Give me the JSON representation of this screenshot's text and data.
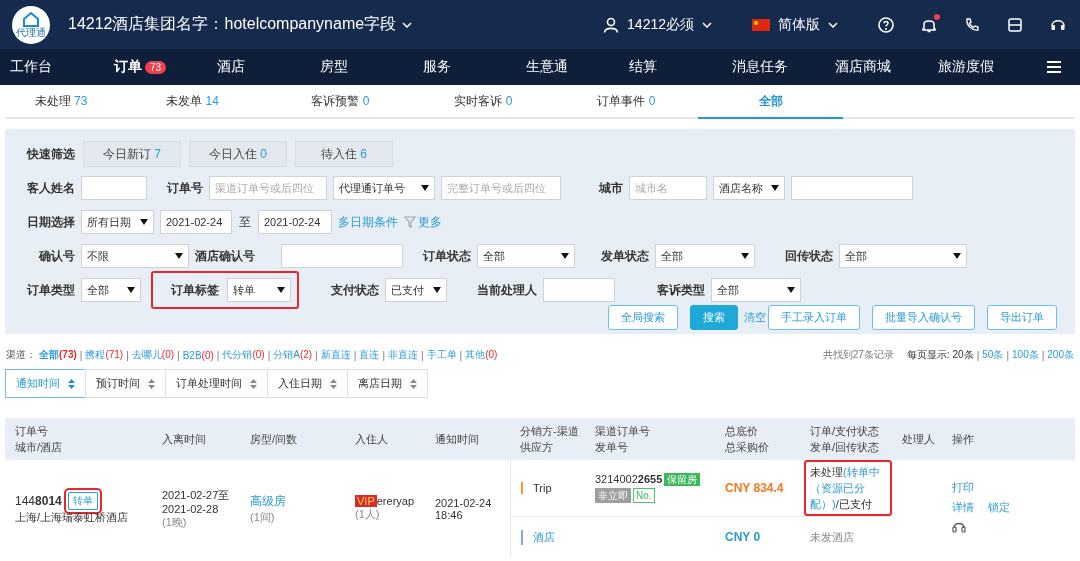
{
  "header": {
    "logo_text": "代理通",
    "company": "14212酒店集团名字：hotelcompanyname字段",
    "user": "14212必须",
    "language": "简体版",
    "notification_dot": true
  },
  "nav": [
    {
      "label": "工作台",
      "selected": false
    },
    {
      "label": "订单",
      "badge": "73",
      "selected": true
    },
    {
      "label": "酒店",
      "selected": false
    },
    {
      "label": "房型",
      "selected": false
    },
    {
      "label": "服务",
      "selected": false
    },
    {
      "label": "生意通",
      "selected": false
    },
    {
      "label": "结算",
      "selected": false
    },
    {
      "label": "消息任务",
      "selected": false
    },
    {
      "label": "酒店商城",
      "selected": false
    },
    {
      "label": "旅游度假",
      "selected": false
    }
  ],
  "subtabs": [
    {
      "label": "未处理",
      "count": "73",
      "selected": false
    },
    {
      "label": "未发单",
      "count": "14",
      "selected": false
    },
    {
      "label": "客诉预警",
      "count": "0",
      "selected": false
    },
    {
      "label": "实时客诉",
      "count": "0",
      "selected": false
    },
    {
      "label": "订单事件",
      "count": "0",
      "selected": false
    },
    {
      "label": "全部",
      "selected": true
    }
  ],
  "filters": {
    "quick": {
      "label": "快速筛选",
      "buttons": [
        {
          "label": "今日新订",
          "count": "7"
        },
        {
          "label": "今日入住",
          "count": "0"
        },
        {
          "label": "待入住",
          "count": "6"
        }
      ]
    },
    "rows": [
      {
        "fields": [
          {
            "kind": "label",
            "text": "客人姓名"
          },
          {
            "kind": "input"
          },
          {
            "kind": "label",
            "text": "订单号"
          },
          {
            "kind": "input",
            "placeholder": "渠道订单号或后四位"
          },
          {
            "kind": "select",
            "value": "代理通订单号"
          },
          {
            "kind": "input",
            "placeholder": "完整订单号或后四位"
          },
          {
            "kind": "label",
            "text": "城市"
          },
          {
            "kind": "input",
            "placeholder": "城市名"
          },
          {
            "kind": "select",
            "value": "酒店名称"
          },
          {
            "kind": "input"
          }
        ]
      },
      {
        "fields": [
          {
            "kind": "label",
            "text": "日期选择"
          },
          {
            "kind": "select",
            "value": "所有日期"
          },
          {
            "kind": "input",
            "value": "2021-02-24"
          },
          {
            "kind": "text",
            "text": "至"
          },
          {
            "kind": "input",
            "value": "2021-02-24"
          },
          {
            "kind": "link",
            "text": "多日期条件"
          },
          {
            "kind": "more",
            "text": "更多"
          }
        ]
      },
      {
        "fields": [
          {
            "kind": "label",
            "text": "确认号"
          },
          {
            "kind": "select",
            "value": "不限"
          },
          {
            "kind": "label",
            "text": "酒店确认号"
          },
          {
            "kind": "input"
          },
          {
            "kind": "label",
            "text": "订单状态"
          },
          {
            "kind": "select",
            "value": "全部"
          },
          {
            "kind": "label",
            "text": "发单状态"
          },
          {
            "kind": "select",
            "value": "全部"
          },
          {
            "kind": "label",
            "text": "回传状态"
          },
          {
            "kind": "select",
            "value": "全部"
          }
        ]
      },
      {
        "fields": [
          {
            "kind": "label",
            "text": "订单类型"
          },
          {
            "kind": "select",
            "value": "全部"
          },
          {
            "kind": "label",
            "text": "订单标签",
            "highlighted": true
          },
          {
            "kind": "select",
            "value": "转单",
            "highlighted": true
          },
          {
            "kind": "label",
            "text": "支付状态"
          },
          {
            "kind": "select",
            "value": "已支付"
          },
          {
            "kind": "label",
            "text": "当前处理人"
          },
          {
            "kind": "input"
          },
          {
            "kind": "label",
            "text": "客诉类型"
          },
          {
            "kind": "select",
            "value": "全部"
          }
        ]
      }
    ],
    "actions": [
      {
        "kind": "outline",
        "label": "全局搜索"
      },
      {
        "kind": "primary",
        "label": "搜索"
      },
      {
        "kind": "link",
        "label": "清空"
      },
      {
        "kind": "outline",
        "label": "手工录入订单"
      },
      {
        "kind": "outline",
        "label": "批量导入确认号"
      },
      {
        "kind": "outline",
        "label": "导出订单"
      }
    ]
  },
  "channels": {
    "label": "渠道：",
    "separator": "|",
    "items": [
      {
        "label": "全部",
        "count": "(73)",
        "selected": true
      },
      {
        "label": "携程",
        "count": "(71)",
        "selected": false
      },
      {
        "label": "去哪儿",
        "count": "(0)",
        "selected": false
      },
      {
        "label": "B2B",
        "count": "(0)",
        "selected": false
      },
      {
        "label": "代分销",
        "count": "(0)",
        "selected": false
      },
      {
        "label": "分销A",
        "count": "(2)",
        "selected": false
      },
      {
        "label": "新直连",
        "selected": false
      },
      {
        "label": "直连",
        "selected": false
      },
      {
        "label": "非直连",
        "selected": false
      },
      {
        "label": "手工单",
        "selected": false
      },
      {
        "label": "其他",
        "count": "(0)",
        "selected": false
      }
    ],
    "records": "共找到27条记录",
    "page_size_label": "每页显示:",
    "page_sizes": [
      {
        "label": "20条",
        "selected": true
      },
      {
        "label": "50条",
        "selected": false
      },
      {
        "label": "100条",
        "selected": false
      },
      {
        "label": "200条",
        "selected": false
      }
    ]
  },
  "sort_buttons": [
    {
      "label": "通知时间",
      "selected": true
    },
    {
      "label": "预订时间",
      "selected": false
    },
    {
      "label": "订单处理时间",
      "selected": false
    },
    {
      "label": "入住日期",
      "selected": false
    },
    {
      "label": "离店日期",
      "selected": false
    }
  ],
  "table": {
    "columns": [
      [
        "订单号",
        "城市/酒店"
      ],
      [
        "入离时间"
      ],
      [
        "房型/间数"
      ],
      [
        "入住人"
      ],
      [
        "通知时间"
      ],
      [
        "分销方-渠道",
        "供应方"
      ],
      [
        "渠道订单号",
        "发单号"
      ],
      [
        "总底价",
        "总采购价"
      ],
      [
        "订单/支付状态",
        "发单/回传状态"
      ],
      [
        "处理人"
      ],
      [
        "操作"
      ]
    ],
    "rows": [
      {
        "order_no": "144**8014**",
        "tag": {
          "label": "转单",
          "highlighted": true
        },
        "city_hotel": "上海/上海瑞泰虹桥酒店",
        "checkin": "2021-02-27至",
        "checkout": "2021-02-28",
        "nights": "(1晚)",
        "room_type": "高级房",
        "rooms": "(1间)",
        "vip": "VIP",
        "guest": "ereryap",
        "guests": "(1人)",
        "notify_date": "2021-02-24",
        "notify_time": "18:46",
        "distributor": {
          "label": "Trip",
          "color": "#f39a2b"
        },
        "channel_order_no": "3214002**2655**",
        "badges": [
          {
            "kind": "green",
            "label": "保留房"
          },
          {
            "kind": "grey",
            "label": "非立即"
          },
          {
            "kind": "outline",
            "label": "No."
          }
        ],
        "total_price": "CNY 834.4",
        "status": {
          "highlighted": true,
          "parts": [
            {
              "kind": "plain",
              "text": "未处理"
            },
            {
              "kind": "link",
              "text": "(转单中（资源已分配）)"
            },
            {
              "kind": "plain",
              "text": "/已支付"
            }
          ]
        },
        "supplier": {
          "label": "酒店",
          "color": "#7fa9d8"
        },
        "purchase_price": "CNY 0",
        "send_status": "未发酒店",
        "actions": [
          "打印",
          "详情",
          "锁定"
        ]
      }
    ]
  }
}
